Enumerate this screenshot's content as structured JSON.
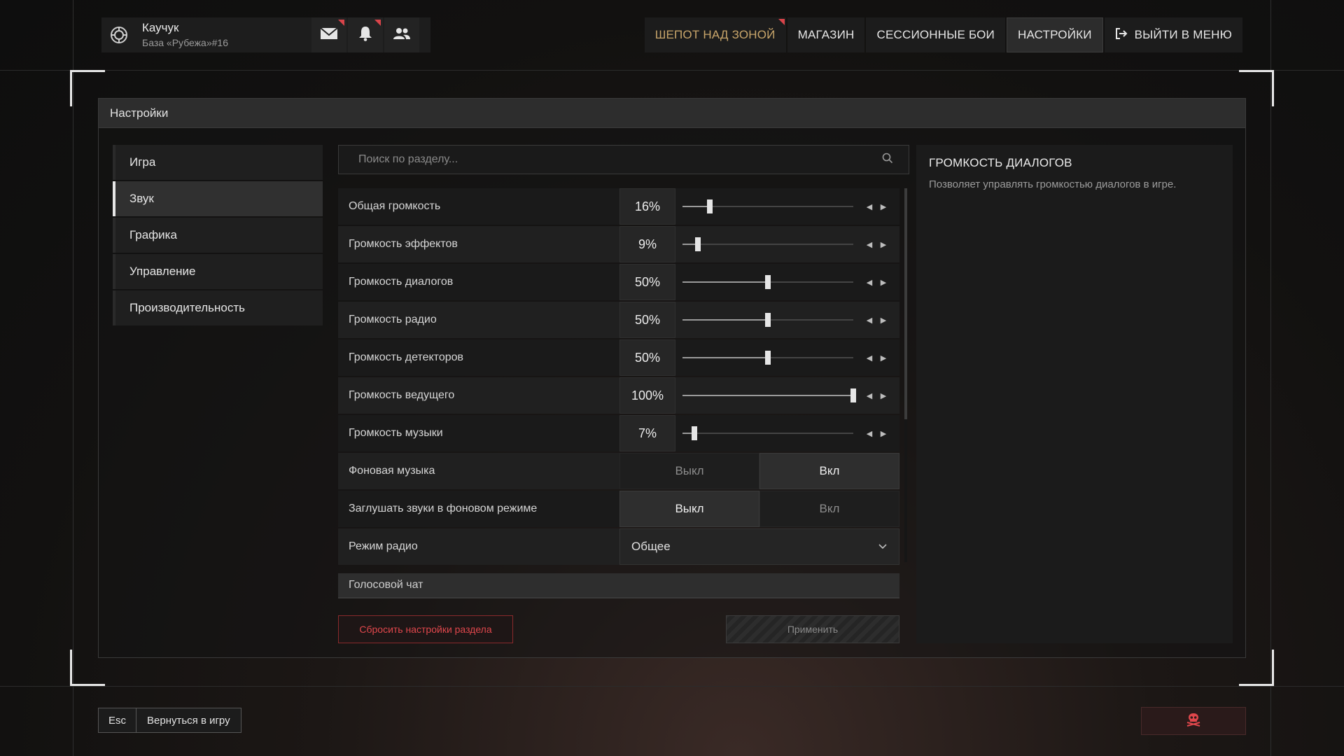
{
  "profile": {
    "name": "Каучук",
    "base": "База «Рубежа»#16"
  },
  "topbar": {
    "icons": [
      "mail-icon",
      "bell-icon",
      "friends-icon"
    ],
    "nav": [
      {
        "label": "ШЕПОТ НАД ЗОНОЙ",
        "state": "highlight"
      },
      {
        "label": "МАГАЗИН",
        "state": "normal"
      },
      {
        "label": "СЕССИОННЫЕ БОИ",
        "state": "normal"
      },
      {
        "label": "НАСТРОЙКИ",
        "state": "active"
      },
      {
        "label": "ВЫЙТИ В МЕНЮ",
        "state": "normal",
        "icon": "exit-icon"
      }
    ]
  },
  "panel": {
    "title": "Настройки"
  },
  "sidebar": {
    "items": [
      {
        "label": "Игра"
      },
      {
        "label": "Звук",
        "active": true
      },
      {
        "label": "Графика"
      },
      {
        "label": "Управление"
      },
      {
        "label": "Производительность"
      }
    ]
  },
  "search": {
    "placeholder": "Поиск по разделу..."
  },
  "settings": {
    "sliders": [
      {
        "label": "Общая громкость",
        "value_text": "16%",
        "percent": 16
      },
      {
        "label": "Громкость эффектов",
        "value_text": "9%",
        "percent": 9
      },
      {
        "label": "Громкость диалогов",
        "value_text": "50%",
        "percent": 50
      },
      {
        "label": "Громкость радио",
        "value_text": "50%",
        "percent": 50
      },
      {
        "label": "Громкость детекторов",
        "value_text": "50%",
        "percent": 50
      },
      {
        "label": "Громкость ведущего",
        "value_text": "100%",
        "percent": 100
      },
      {
        "label": "Громкость музыки",
        "value_text": "7%",
        "percent": 7
      }
    ],
    "toggles": [
      {
        "label": "Фоновая музыка",
        "off": "Выкл",
        "on": "Вкл",
        "selected": "on"
      },
      {
        "label": "Заглушать звуки в фоновом режиме",
        "off": "Выкл",
        "on": "Вкл",
        "selected": "off"
      }
    ],
    "select": {
      "label": "Режим радио",
      "value": "Общее"
    },
    "section": "Голосовой чат"
  },
  "buttons": {
    "reset": "Сбросить настройки раздела",
    "apply": "Применить"
  },
  "description": {
    "title": "ГРОМКОСТЬ ДИАЛОГОВ",
    "text": "Позволяет управлять громкостью диалогов в игре."
  },
  "footer": {
    "key": "Esc",
    "back": "Вернуться в игру"
  },
  "colors": {
    "accent_red": "#d9444a",
    "highlight_gold": "#c8a56a"
  }
}
